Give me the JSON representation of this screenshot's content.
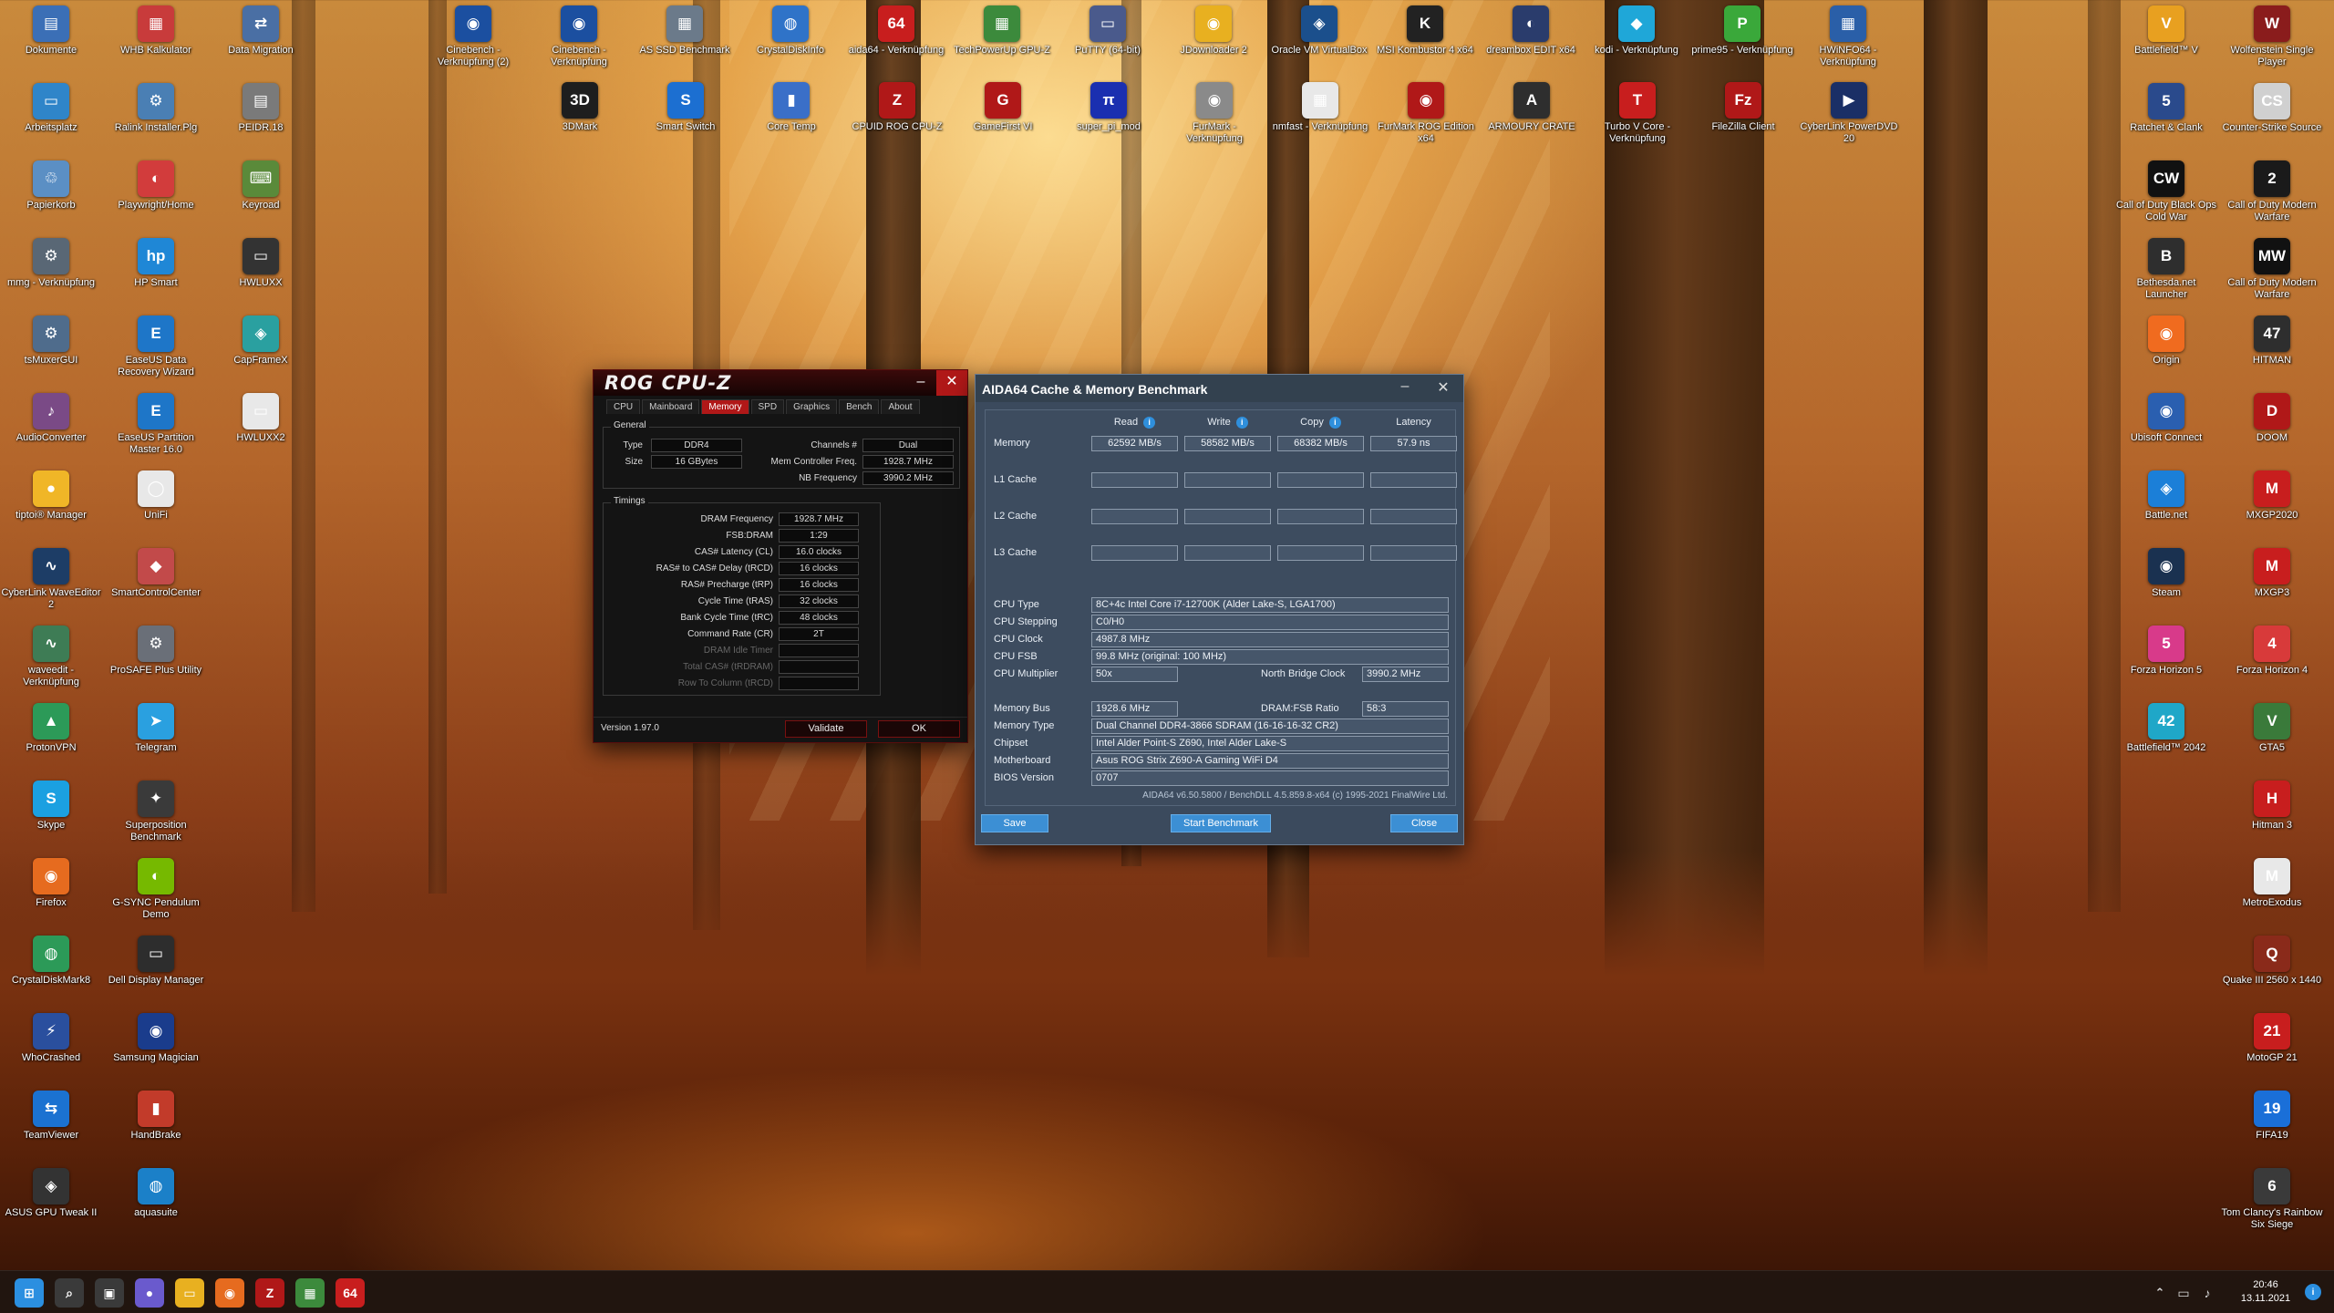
{
  "desktop": {
    "left_icons": [
      {
        "label": "Dokumente",
        "color": "#3b6fb6",
        "glyph": "▤"
      },
      {
        "label": "Arbeitsplatz",
        "color": "#2f85c9",
        "glyph": "▭"
      },
      {
        "label": "Papierkorb",
        "color": "#5b8fc4",
        "glyph": "♲"
      },
      {
        "label": "mmg - Verknüpfung",
        "color": "#596775",
        "glyph": "⚙"
      },
      {
        "label": "tsMuxerGUI",
        "color": "#4f6c8c",
        "glyph": "⚙"
      },
      {
        "label": "AudioConverter",
        "color": "#7a4a86",
        "glyph": "♪"
      },
      {
        "label": "tiptoi® Manager",
        "color": "#f0b627",
        "glyph": "●"
      },
      {
        "label": "CyberLink WaveEditor 2",
        "color": "#1d3d66",
        "glyph": "∿"
      },
      {
        "label": "waveedit - Verknüpfung",
        "color": "#3e7c55",
        "glyph": "∿"
      },
      {
        "label": "ProtonVPN",
        "color": "#2c9a58",
        "glyph": "▲"
      },
      {
        "label": "Skype",
        "color": "#1ba0e1",
        "glyph": "S"
      },
      {
        "label": "Firefox",
        "color": "#e66b1f",
        "glyph": "◉"
      },
      {
        "label": "CrystalDiskMark8",
        "color": "#2c9a58",
        "glyph": "◍"
      },
      {
        "label": "WhoCrashed",
        "color": "#2a4f9e",
        "glyph": "⚡"
      },
      {
        "label": "TeamViewer",
        "color": "#1b72d1",
        "glyph": "⇆"
      },
      {
        "label": "ASUS GPU Tweak II",
        "color": "#333333",
        "glyph": "◈"
      }
    ],
    "second_column_icons": [
      {
        "label": "WHB Kalkulator",
        "color": "#c83b3b",
        "glyph": "▦"
      },
      {
        "label": "Ralink Installer.Plg",
        "color": "#4a7fb4",
        "glyph": "⚙"
      },
      {
        "label": "Playwright/Home",
        "color": "#d23c3c",
        "glyph": "◐"
      },
      {
        "label": "HP Smart",
        "color": "#1f87d6",
        "glyph": "hp"
      },
      {
        "label": "EaseUS Data Recovery Wizard",
        "color": "#1e76c8",
        "glyph": "E"
      },
      {
        "label": "EaseUS Partition Master 16.0",
        "color": "#1e76c8",
        "glyph": "E"
      },
      {
        "label": "UniFi",
        "color": "#e8e8e8",
        "glyph": "◯"
      },
      {
        "label": "SmartControlCenter",
        "color": "#c24a4a",
        "glyph": "◆"
      },
      {
        "label": "ProSAFE Plus Utility",
        "color": "#6a6f78",
        "glyph": "⚙"
      },
      {
        "label": "Telegram",
        "color": "#2aa0e0",
        "glyph": "➤"
      },
      {
        "label": "Superposition Benchmark",
        "color": "#3a3a3a",
        "glyph": "✦"
      },
      {
        "label": "G-SYNC Pendulum Demo",
        "color": "#76b900",
        "glyph": "◐"
      },
      {
        "label": "Dell Display Manager",
        "color": "#2d2d2d",
        "glyph": "▭"
      },
      {
        "label": "Samsung Magician",
        "color": "#1a3c8c",
        "glyph": "◉"
      },
      {
        "label": "HandBrake",
        "color": "#c23b2a",
        "glyph": "▮"
      },
      {
        "label": "aquasuite",
        "color": "#1b80c8",
        "glyph": "◍"
      }
    ],
    "third_column_icons": [
      {
        "label": "Data Migration",
        "color": "#4a6fa4",
        "glyph": "⇄"
      },
      {
        "label": "PEIDR.18",
        "color": "#7a7a7a",
        "glyph": "▤"
      },
      {
        "label": "Keyroad",
        "color": "#5a8a3a",
        "glyph": "⌨"
      },
      {
        "label": "HWLUXX",
        "color": "#333333",
        "glyph": "▭"
      },
      {
        "label": "CapFrameX",
        "color": "#2aa0a0",
        "glyph": "◈"
      },
      {
        "label": "HWLUXX2",
        "color": "#e8e8e8",
        "glyph": "▭"
      }
    ],
    "top_row_icons": [
      {
        "label": "Cinebench - Verknüpfung (2)",
        "color": "#1b4fa0",
        "glyph": "◉"
      },
      {
        "label": "Cinebench - Verknüpfung",
        "color": "#1b4fa0",
        "glyph": "◉"
      },
      {
        "label": "AS SSD Benchmark",
        "color": "#6b7a8a",
        "glyph": "▦"
      },
      {
        "label": "CrystalDiskInfo",
        "color": "#2f73c8",
        "glyph": "◍"
      },
      {
        "label": "aida64 - Verknüpfung",
        "color": "#c81e1e",
        "glyph": "64"
      },
      {
        "label": "TechPowerUp GPU-Z",
        "color": "#3c8a3c",
        "glyph": "▦"
      },
      {
        "label": "PuTTY (64-bit)",
        "color": "#4a5a8c",
        "glyph": "▭"
      },
      {
        "label": "JDownloader 2",
        "color": "#e8b020",
        "glyph": "◉"
      },
      {
        "label": "Oracle VM VirtualBox",
        "color": "#1b4f8c",
        "glyph": "◈"
      },
      {
        "label": "MSI Kombustor 4 x64",
        "color": "#222222",
        "glyph": "K"
      },
      {
        "label": "dreambox EDIT x64",
        "color": "#2a3c6c",
        "glyph": "◐"
      },
      {
        "label": "kodi - Verknüpfung",
        "color": "#1fa7d8",
        "glyph": "◆"
      },
      {
        "label": "prime95 - Verknüpfung",
        "color": "#3aa83a",
        "glyph": "P"
      },
      {
        "label": "HWiNFO64 - Verknüpfung",
        "color": "#2a5fa8",
        "glyph": "▦"
      }
    ],
    "second_row_icons": [
      {
        "label": "3DMark",
        "color": "#1e1e1e",
        "glyph": "3D"
      },
      {
        "label": "Smart Switch",
        "color": "#1c6fd1",
        "glyph": "S"
      },
      {
        "label": "Core Temp",
        "color": "#3a6fc8",
        "glyph": "▮"
      },
      {
        "label": "CPUID ROG CPU-Z",
        "color": "#b01818",
        "glyph": "Z"
      },
      {
        "label": "GameFirst VI",
        "color": "#b01818",
        "glyph": "G"
      },
      {
        "label": "super_pi_mod",
        "color": "#1a2fb0",
        "glyph": "π"
      },
      {
        "label": "FurMark - Verknüpfung",
        "color": "#8a8a8a",
        "glyph": "◉"
      },
      {
        "label": "nmfast - Verknüpfung",
        "color": "#e8e8e8",
        "glyph": "▦"
      },
      {
        "label": "FurMark ROG Edition x64",
        "color": "#b01818",
        "glyph": "◉"
      },
      {
        "label": "ARMOURY CRATE",
        "color": "#2e2e2e",
        "glyph": "A"
      },
      {
        "label": "Turbo V Core - Verknüpfung",
        "color": "#c81e1e",
        "glyph": "T"
      },
      {
        "label": "FileZilla Client",
        "color": "#b01818",
        "glyph": "Fz"
      },
      {
        "label": "CyberLink PowerDVD 20",
        "color": "#1a2f66",
        "glyph": "▶"
      }
    ],
    "right_icons": [
      {
        "label": "Battlefield™ V",
        "color": "#e8a020",
        "glyph": "V"
      },
      {
        "label": "Ratchet & Clank",
        "color": "#2a4a8c",
        "glyph": "5"
      },
      {
        "label": "Call of Duty Black Ops Cold War",
        "color": "#111111",
        "glyph": "CW"
      },
      {
        "label": "Bethesda.net Launcher",
        "color": "#2e2e2e",
        "glyph": "B"
      },
      {
        "label": "Origin",
        "color": "#f06b1f",
        "glyph": "◉"
      },
      {
        "label": "Ubisoft Connect",
        "color": "#2a5fb0",
        "glyph": "◉"
      },
      {
        "label": "Battle.net",
        "color": "#1b7fd8",
        "glyph": "◈"
      },
      {
        "label": "Steam",
        "color": "#1a3150",
        "glyph": "◉"
      },
      {
        "label": "Forza Horizon 5",
        "color": "#d83a8a",
        "glyph": "5"
      },
      {
        "label": "Battlefield™ 2042",
        "color": "#1fa7c8",
        "glyph": "42"
      }
    ],
    "far_right_icons": [
      {
        "label": "Wolfenstein Single Player",
        "color": "#8a1c1c",
        "glyph": "W"
      },
      {
        "label": "Counter-Strike Source",
        "color": "#d0d0d0",
        "glyph": "CS"
      },
      {
        "label": "Call of Duty Modern Warfare",
        "color": "#1a1a1a",
        "glyph": "2"
      },
      {
        "label": "Call of Duty Modern Warfare",
        "color": "#111111",
        "glyph": "MW"
      },
      {
        "label": "HITMAN",
        "color": "#2e2e2e",
        "glyph": "47"
      },
      {
        "label": "DOOM",
        "color": "#b01818",
        "glyph": "D"
      },
      {
        "label": "MXGP2020",
        "color": "#c81e1e",
        "glyph": "M"
      },
      {
        "label": "MXGP3",
        "color": "#c81e1e",
        "glyph": "M"
      },
      {
        "label": "Forza Horizon 4",
        "color": "#d83a3a",
        "glyph": "4"
      },
      {
        "label": "GTA5",
        "color": "#3a7a3a",
        "glyph": "V"
      },
      {
        "label": "Hitman 3",
        "color": "#c81e1e",
        "glyph": "H"
      },
      {
        "label": "MetroExodus",
        "color": "#e8e8e8",
        "glyph": "M"
      },
      {
        "label": "Quake III 2560 x 1440",
        "color": "#8a2a1a",
        "glyph": "Q"
      },
      {
        "label": "MotoGP 21",
        "color": "#c81e1e",
        "glyph": "21"
      },
      {
        "label": "FIFA19",
        "color": "#1a6fd8",
        "glyph": "19"
      },
      {
        "label": "Tom Clancy's Rainbow Six Siege",
        "color": "#3a3a3a",
        "glyph": "6"
      }
    ]
  },
  "cpuz": {
    "title": "ROG CPU-Z",
    "tabs": [
      "CPU",
      "Mainboard",
      "Memory",
      "SPD",
      "Graphics",
      "Bench",
      "About"
    ],
    "active_tab": "Memory",
    "general_legend": "General",
    "type_label": "Type",
    "type_value": "DDR4",
    "size_label": "Size",
    "size_value": "16 GBytes",
    "channels_label": "Channels #",
    "channels_value": "Dual",
    "mc_freq_label": "Mem Controller Freq.",
    "mc_freq_value": "1928.7 MHz",
    "nb_freq_label": "NB Frequency",
    "nb_freq_value": "3990.2 MHz",
    "timings_legend": "Timings",
    "timings": [
      {
        "label": "DRAM Frequency",
        "value": "1928.7 MHz",
        "dim": false
      },
      {
        "label": "FSB:DRAM",
        "value": "1:29",
        "dim": false
      },
      {
        "label": "CAS# Latency (CL)",
        "value": "16.0 clocks",
        "dim": false
      },
      {
        "label": "RAS# to CAS# Delay (tRCD)",
        "value": "16 clocks",
        "dim": false
      },
      {
        "label": "RAS# Precharge (tRP)",
        "value": "16 clocks",
        "dim": false
      },
      {
        "label": "Cycle Time (tRAS)",
        "value": "32 clocks",
        "dim": false
      },
      {
        "label": "Bank Cycle Time (tRC)",
        "value": "48 clocks",
        "dim": false
      },
      {
        "label": "Command Rate (CR)",
        "value": "2T",
        "dim": false
      },
      {
        "label": "DRAM Idle Timer",
        "value": "",
        "dim": true
      },
      {
        "label": "Total CAS# (tRDRAM)",
        "value": "",
        "dim": true
      },
      {
        "label": "Row To Column (tRCD)",
        "value": "",
        "dim": true
      }
    ],
    "version": "Version 1.97.0",
    "validate_label": "Validate",
    "ok_label": "OK",
    "minimize": "–",
    "close": "✕"
  },
  "aida": {
    "title": "AIDA64 Cache & Memory Benchmark",
    "minimize": "–",
    "close": "✕",
    "columns": [
      "Read",
      "Write",
      "Copy",
      "Latency"
    ],
    "rows": [
      {
        "label": "Memory",
        "values": [
          "62592 MB/s",
          "58582 MB/s",
          "68382 MB/s",
          "57.9 ns"
        ]
      },
      {
        "label": "L1 Cache",
        "values": [
          "",
          "",
          "",
          ""
        ]
      },
      {
        "label": "L2 Cache",
        "values": [
          "",
          "",
          "",
          ""
        ]
      },
      {
        "label": "L3 Cache",
        "values": [
          "",
          "",
          "",
          ""
        ]
      }
    ],
    "cpu_type_label": "CPU Type",
    "cpu_type": "8C+4c Intel Core i7-12700K  (Alder Lake-S, LGA1700)",
    "cpu_stepping_label": "CPU Stepping",
    "cpu_stepping": "C0/H0",
    "cpu_clock_label": "CPU Clock",
    "cpu_clock": "4987.8 MHz",
    "cpu_fsb_label": "CPU FSB",
    "cpu_fsb": "99.8 MHz  (original: 100 MHz)",
    "cpu_mult_label": "CPU Multiplier",
    "cpu_mult": "50x",
    "nb_clock_label": "North Bridge Clock",
    "nb_clock": "3990.2 MHz",
    "mem_bus_label": "Memory Bus",
    "mem_bus": "1928.6 MHz",
    "dram_fsb_label": "DRAM:FSB Ratio",
    "dram_fsb": "58:3",
    "mem_type_label": "Memory Type",
    "mem_type": "Dual Channel DDR4-3866 SDRAM  (16-16-16-32 CR2)",
    "chipset_label": "Chipset",
    "chipset": "Intel Alder Point-S Z690, Intel Alder Lake-S",
    "mobo_label": "Motherboard",
    "mobo": "Asus ROG Strix Z690-A Gaming WiFi D4",
    "bios_label": "BIOS Version",
    "bios": "0707",
    "copyright": "AIDA64 v6.50.5800 / BenchDLL 4.5.859.8-x64  (c) 1995-2021 FinalWire Ltd.",
    "save_label": "Save",
    "start_label": "Start Benchmark",
    "close_label": "Close"
  },
  "taskbar": {
    "time": "20:46",
    "date": "13.11.2021",
    "apps": [
      {
        "name": "start-button",
        "glyph": "⊞",
        "color": "#2b8fe0"
      },
      {
        "name": "search-icon",
        "glyph": "⌕",
        "color": "#3a3a3a"
      },
      {
        "name": "task-view-icon",
        "glyph": "▣",
        "color": "#3a3a3a"
      },
      {
        "name": "chat-icon",
        "glyph": "●",
        "color": "#6a5acd"
      },
      {
        "name": "file-explorer-icon",
        "glyph": "▭",
        "color": "#e8b020"
      },
      {
        "name": "firefox-icon",
        "glyph": "◉",
        "color": "#e66b1f"
      },
      {
        "name": "cpuz-taskbar-icon",
        "glyph": "Z",
        "color": "#b01818"
      },
      {
        "name": "gpu-z-taskbar-icon",
        "glyph": "▦",
        "color": "#3c8a3c"
      },
      {
        "name": "aida64-taskbar-icon",
        "glyph": "64",
        "color": "#c81e1e"
      }
    ]
  }
}
